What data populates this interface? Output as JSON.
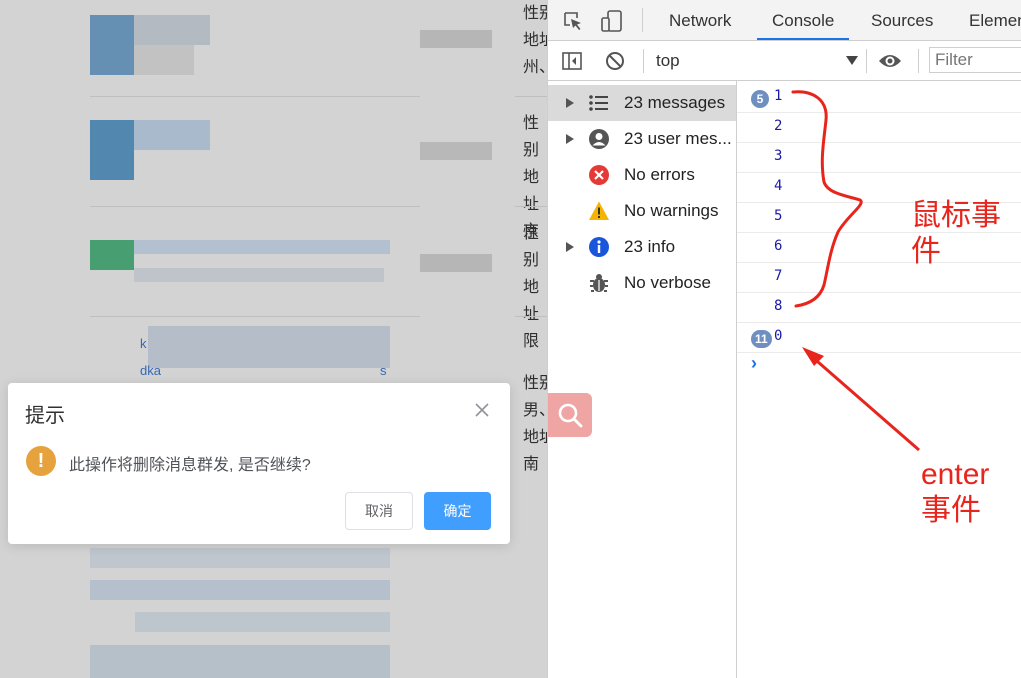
{
  "page": {
    "rows": [
      {
        "lines": [
          "性别",
          "地址",
          "州、"
        ]
      },
      {
        "lines": [
          "性别",
          "地址",
          "京"
        ]
      },
      {
        "lines": [
          "性别",
          "地址",
          "限"
        ]
      },
      {
        "lines": [
          "性别",
          "男、",
          "地址",
          "南"
        ]
      }
    ],
    "link_fragments": [
      "k",
      "dka",
      "s"
    ]
  },
  "dialog": {
    "title": "提示",
    "message": "此操作将删除消息群发, 是否继续?",
    "cancel_label": "取消",
    "confirm_label": "确定",
    "warning_glyph": "!"
  },
  "devtools": {
    "tabs": [
      "Network",
      "Console",
      "Sources",
      "Elemen"
    ],
    "active_tab": "Console",
    "context": "top",
    "filter_placeholder": "Filter",
    "sidebar": [
      {
        "label": "23 messages",
        "icon": "list-icon",
        "expandable": true,
        "selected": true
      },
      {
        "label": "23 user mes...",
        "icon": "user-icon",
        "expandable": true,
        "selected": false
      },
      {
        "label": "No errors",
        "icon": "error-icon",
        "expandable": false,
        "selected": false
      },
      {
        "label": "No warnings",
        "icon": "warning-icon",
        "expandable": false,
        "selected": false
      },
      {
        "label": "23 info",
        "icon": "info-icon",
        "expandable": true,
        "selected": false
      },
      {
        "label": "No verbose",
        "icon": "bug-icon",
        "expandable": false,
        "selected": false
      }
    ],
    "console_rows": [
      {
        "badge": "5",
        "value": "1"
      },
      {
        "badge": "",
        "value": "2"
      },
      {
        "badge": "",
        "value": "3"
      },
      {
        "badge": "",
        "value": "4"
      },
      {
        "badge": "",
        "value": "5"
      },
      {
        "badge": "",
        "value": "6"
      },
      {
        "badge": "",
        "value": "7"
      },
      {
        "badge": "",
        "value": "8"
      },
      {
        "badge": "11",
        "value": "0"
      }
    ],
    "prompt_glyph": "›"
  },
  "annotations": {
    "mouse_label_line1": "鼠标事",
    "mouse_label_line2": "件",
    "enter_label_line1": "enter",
    "enter_label_line2": "事件",
    "color": "#e8251c"
  }
}
